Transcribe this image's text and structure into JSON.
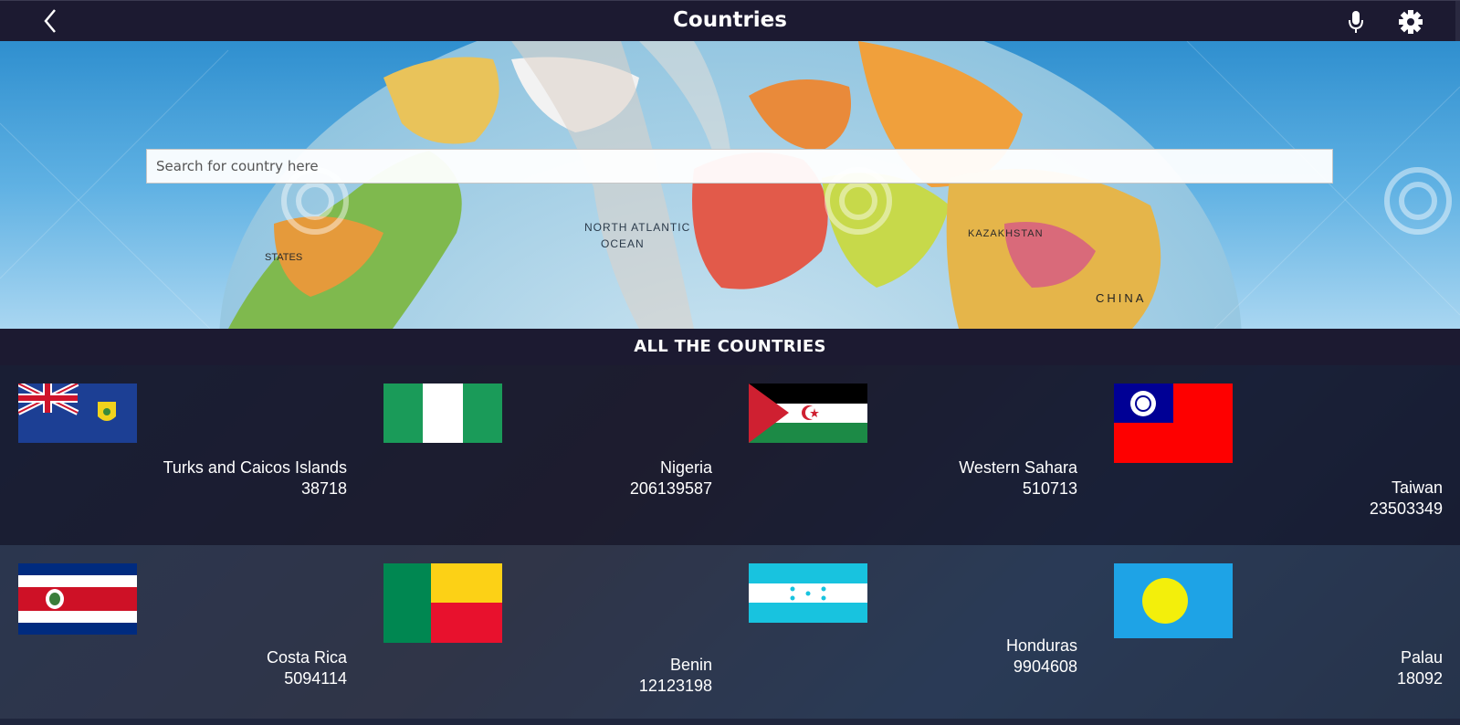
{
  "header": {
    "title": "Countries",
    "back_icon": "chevron-left-icon",
    "mic_icon": "microphone-icon",
    "settings_icon": "gear-icon"
  },
  "search": {
    "placeholder": "Search for country here",
    "value": ""
  },
  "section": {
    "title": "ALL THE COUNTRIES"
  },
  "countries": [
    {
      "name": "Turks and Caicos Islands",
      "population": "38718",
      "flag": "turks-and-caicos-flag"
    },
    {
      "name": "Nigeria",
      "population": "206139587",
      "flag": "nigeria-flag"
    },
    {
      "name": "Western Sahara",
      "population": "510713",
      "flag": "western-sahara-flag"
    },
    {
      "name": "Taiwan",
      "population": "23503349",
      "flag": "taiwan-flag"
    },
    {
      "name": "Costa Rica",
      "population": "5094114",
      "flag": "costa-rica-flag"
    },
    {
      "name": "Benin",
      "population": "12123198",
      "flag": "benin-flag"
    },
    {
      "name": "Honduras",
      "population": "9904608",
      "flag": "honduras-flag"
    },
    {
      "name": "Palau",
      "population": "18092",
      "flag": "palau-flag"
    }
  ],
  "colors": {
    "app_bar": "#1c1a31",
    "card_dark": "#121428",
    "card_light": "#28344e"
  }
}
